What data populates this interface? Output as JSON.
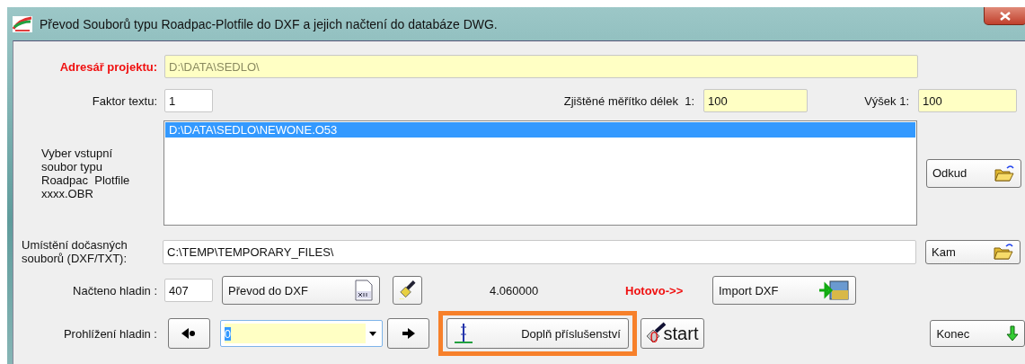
{
  "window": {
    "title": "Převod Souborů typu Roadpac-Plotfile do DXF a jejich načtení do databáze DWG."
  },
  "project": {
    "label": "Adresář projektu:",
    "value": "D:\\DATA\\SEDLO\\",
    "readonly": true
  },
  "text_factor": {
    "label": "Faktor textu:",
    "value": "1"
  },
  "scale_length": {
    "label": "Zjištěné měřítko délek  1:",
    "value": "100"
  },
  "scale_height": {
    "label": "Výšek 1:",
    "value": "100"
  },
  "input_files": {
    "label": "Vyber vstupní soubor typu Roadpac  Plotfile xxxx.OBR",
    "items": [
      {
        "text": "D:\\DATA\\SEDLO\\NEWONE.O53",
        "selected": true
      }
    ],
    "button": "Odkud"
  },
  "temp_dir": {
    "label": "Umístění dočasných souborů (DXF/TXT):",
    "value": "C:\\TEMP\\TEMPORARY_FILES\\",
    "button": "Kam"
  },
  "loaded": {
    "label": "Načteno hladin :",
    "value": "407",
    "convert_button": "Převod do DXF",
    "version": "4.060000",
    "done_label": "Hotovo->>",
    "import_button": "Import DXF"
  },
  "browse": {
    "label": "Prohlížení hladin :",
    "combo_value": "0",
    "complete_button": "Doplň příslušenství",
    "complete_highlighted": true,
    "start_button": "start",
    "start_badge": "0",
    "exit_button": "Konec"
  }
}
